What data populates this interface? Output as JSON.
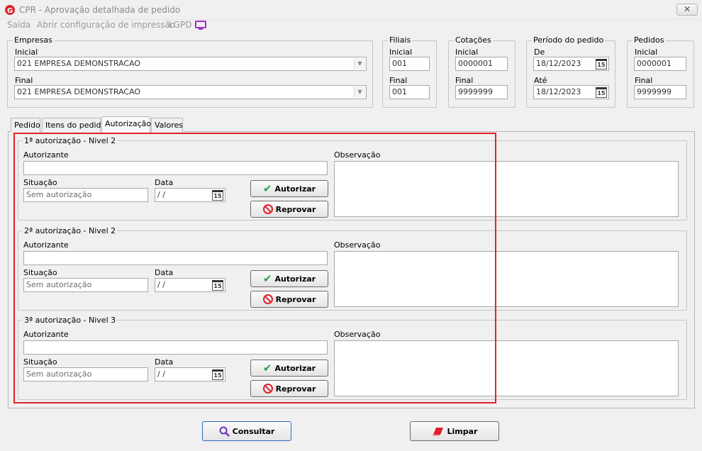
{
  "window": {
    "title": "CPR - Aprovação detalhada de pedido",
    "close_symbol": "✕"
  },
  "menu": [
    {
      "label": "Saída",
      "key": "saida"
    },
    {
      "label": "Abrir configuração de impressão",
      "key": "abrir"
    },
    {
      "label": "LGPD",
      "key": "lgpd"
    }
  ],
  "empresas": {
    "legend": "Empresas",
    "inicial_label": "Inicial",
    "inicial_value": "021 EMPRESA DEMONSTRACAO",
    "final_label": "Final",
    "final_value": "021 EMPRESA DEMONSTRACAO"
  },
  "filiais": {
    "legend": "Filiais",
    "inicial_label": "Inicial",
    "inicial_value": "001",
    "final_label": "Final",
    "final_value": "001"
  },
  "cotacoes": {
    "legend": "Cotações",
    "inicial_label": "Inicial",
    "inicial_value": "0000001",
    "final_label": "Final",
    "final_value": "9999999"
  },
  "periodo": {
    "legend": "Período do pedido",
    "de_label": "De",
    "de_value": "18/12/2023",
    "ate_label": "Até",
    "ate_value": "18/12/2023"
  },
  "pedidos": {
    "legend": "Pedidos",
    "inicial_label": "Inicial",
    "inicial_value": "0000001",
    "final_label": "Final",
    "final_value": "9999999"
  },
  "tabs": [
    "Pedido",
    "Itens do pedido",
    "Autorização",
    "Valores"
  ],
  "active_tab": "Autorização",
  "autorizacoes": [
    {
      "legend": "1ª autorização - Nivel 2",
      "autorizante_label": "Autorizante",
      "autorizante_value": "",
      "situacao_label": "Situação",
      "situacao_value": "Sem autorização",
      "data_label": "Data",
      "data_value": " /  /",
      "autorizar_label": "Autorizar",
      "reprovar_label": "Reprovar",
      "observacao_label": "Observação"
    },
    {
      "legend": "2ª autorização - Nivel 2",
      "autorizante_label": "Autorizante",
      "autorizante_value": "",
      "situacao_label": "Situação",
      "situacao_value": "Sem autorização",
      "data_label": "Data",
      "data_value": " /  /",
      "autorizar_label": "Autorizar",
      "reprovar_label": "Reprovar",
      "observacao_label": "Observação"
    },
    {
      "legend": "3ª autorização - Nivel 3",
      "autorizante_label": "Autorizante",
      "autorizante_value": "",
      "situacao_label": "Situação",
      "situacao_value": "Sem autorização",
      "data_label": "Data",
      "data_value": " /  /",
      "autorizar_label": "Autorizar",
      "reprovar_label": "Reprovar",
      "observacao_label": "Observação"
    }
  ],
  "calendar_icon_text": "15",
  "footer": {
    "consultar_label": "Consultar",
    "limpar_label": "Limpar"
  },
  "colors": {
    "highlight": "#e2232a",
    "logo": "#d9262c",
    "lgpd_icon": "#9b30c9",
    "check": "#23a24d",
    "ban": "#e0202a",
    "search": "#6a2fc2",
    "eraser": "#e0202a"
  }
}
